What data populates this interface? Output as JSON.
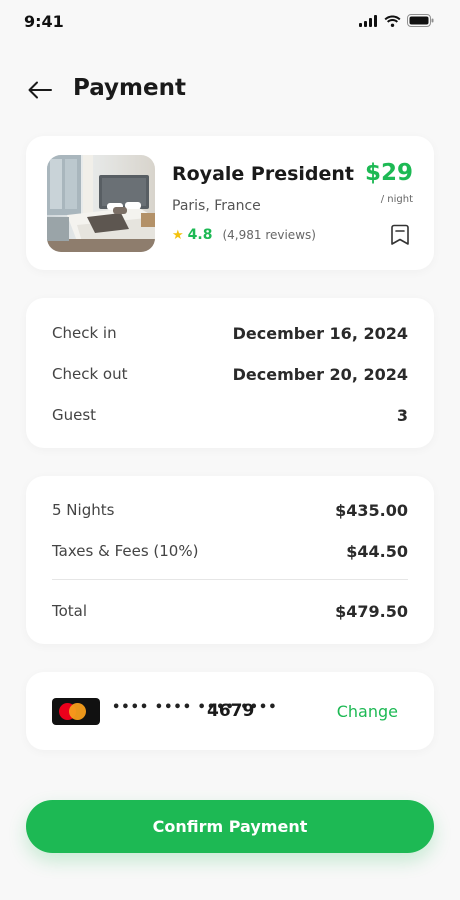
{
  "status_bar": {
    "time": "9:41"
  },
  "header": {
    "title": "Payment"
  },
  "hotel": {
    "name": "Royale President",
    "location": "Paris, France",
    "rating": "4.8",
    "reviews": "(4,981 reviews)",
    "price": "$29",
    "price_unit": "/ night"
  },
  "booking": {
    "rows": [
      {
        "label": "Check in",
        "value": "December 16, 2024"
      },
      {
        "label": "Check out",
        "value": "December 20, 2024"
      },
      {
        "label": "Guest",
        "value": "3"
      }
    ]
  },
  "costs": {
    "rows": [
      {
        "label": "5 Nights",
        "value": "$435.00"
      },
      {
        "label": "Taxes & Fees (10%)",
        "value": "$44.50"
      }
    ],
    "total": {
      "label": "Total",
      "value": "$479.50"
    }
  },
  "payment": {
    "masked": "•••• •••• •••• ••••",
    "last4": "4679",
    "change_label": "Change",
    "card_brand": "mastercard-icon"
  },
  "confirm_label": "Confirm Payment",
  "colors": {
    "accent": "#1db954",
    "background": "#f8f8f8",
    "card": "#ffffff",
    "star": "#f4c20d"
  }
}
